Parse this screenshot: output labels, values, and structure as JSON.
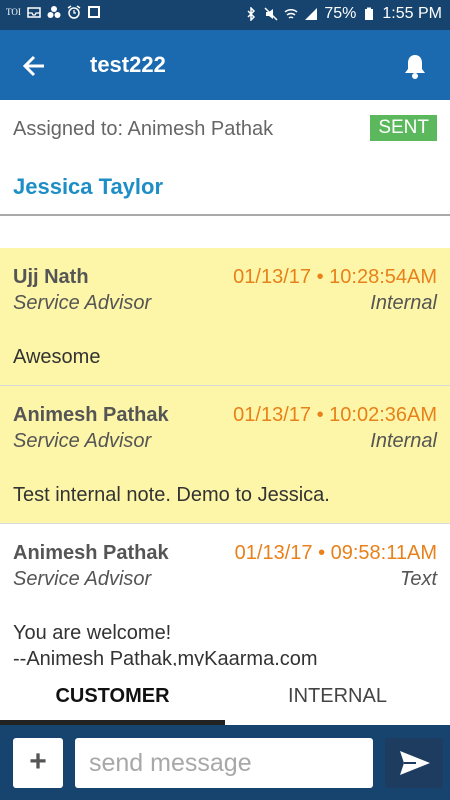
{
  "status_bar": {
    "toi_label": "TOI",
    "battery_pct": "75%",
    "time": "1:55 PM",
    "icons": [
      "toi-icon",
      "inbox-icon",
      "dots-icon",
      "alarm-icon",
      "screenshot-icon",
      "bluetooth-icon",
      "mute-icon",
      "wifi-icon",
      "signal-icon",
      "battery-icon"
    ]
  },
  "app_bar": {
    "title": "test222",
    "back_icon": "back-arrow-icon",
    "bell_icon": "bell-icon",
    "color": "#1b6aaf"
  },
  "header": {
    "assigned": "Assigned to: Animesh Pathak",
    "status_badge": "SENT",
    "status_color": "#5cb85c",
    "customer_name": "Jessica Taylor"
  },
  "messages": [
    {
      "sender": "Ujj Nath",
      "timestamp": "01/13/17 • 10:28:54AM",
      "role": "Service Advisor",
      "kind": "Internal",
      "body": "Awesome",
      "background": "#fdf6a8"
    },
    {
      "sender": "Animesh Pathak",
      "timestamp": "01/13/17 • 10:02:36AM",
      "role": "Service Advisor",
      "kind": "Internal",
      "body": "Test internal note. Demo to Jessica.",
      "background": "#fdf6a8"
    },
    {
      "sender": "Animesh Pathak",
      "timestamp": "01/13/17 • 09:58:11AM",
      "role": "Service Advisor",
      "kind": "Text",
      "body": "You are welcome!\n--Animesh Pathak,myKaarma.com",
      "background": "#ffffff"
    }
  ],
  "tabs": {
    "customer": "CUSTOMER",
    "internal": "INTERNAL",
    "active": "customer"
  },
  "composer": {
    "plus_label": "+",
    "placeholder": "send message",
    "send_icon": "send-icon"
  }
}
